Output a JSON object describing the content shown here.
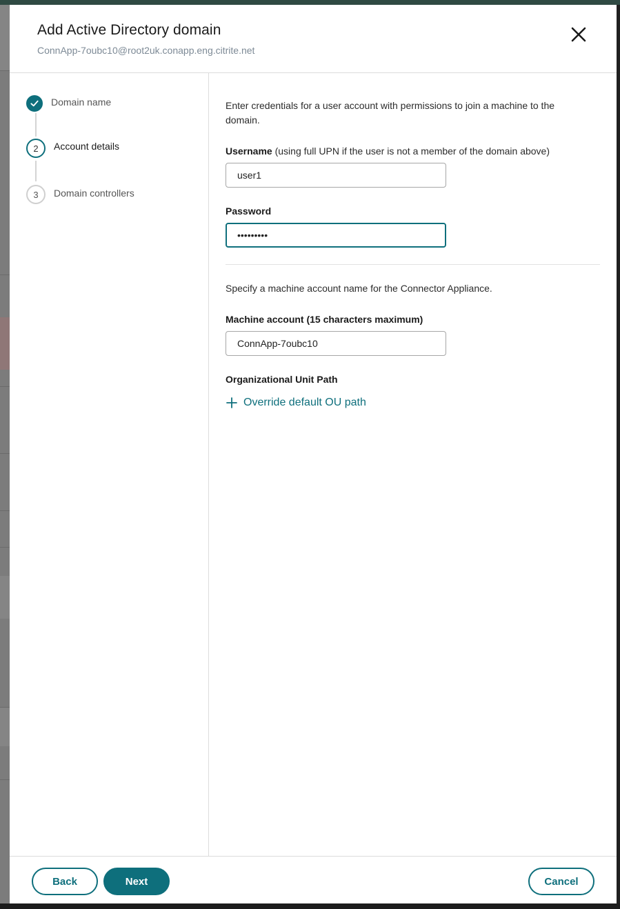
{
  "dialog": {
    "title": "Add Active Directory domain",
    "subtitle": "ConnApp-7oubc10@root2uk.conapp.eng.citrite.net"
  },
  "steps": [
    {
      "number": "1",
      "label": "Domain name",
      "state": "completed"
    },
    {
      "number": "2",
      "label": "Account details",
      "state": "active"
    },
    {
      "number": "3",
      "label": "Domain controllers",
      "state": "pending"
    }
  ],
  "form": {
    "intro": "Enter credentials for a user account with permissions to join a machine to the domain.",
    "username_label": "Username",
    "username_note": " (using full UPN if the user is not a member of the domain above)",
    "username_value": "user1",
    "password_label": "Password",
    "password_value": "•••••••••",
    "machine_intro": "Specify a machine account name for the Connector Appliance.",
    "machine_label": "Machine account (15 characters maximum)",
    "machine_value": "ConnApp-7oubc10",
    "ou_label": "Organizational Unit Path",
    "ou_link": "Override default OU path"
  },
  "footer": {
    "back": "Back",
    "next": "Next",
    "cancel": "Cancel"
  },
  "colors": {
    "accent": "#0e6f7c",
    "border": "#a6a6a6",
    "subtitle": "#7d8a96"
  }
}
